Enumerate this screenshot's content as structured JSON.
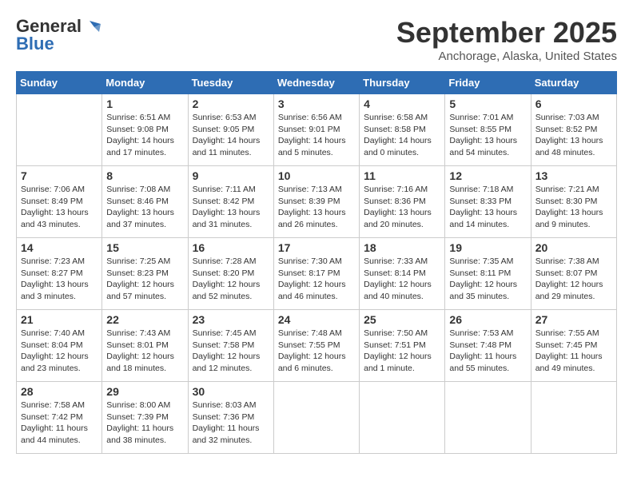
{
  "header": {
    "logo_general": "General",
    "logo_blue": "Blue",
    "month": "September 2025",
    "location": "Anchorage, Alaska, United States"
  },
  "weekdays": [
    "Sunday",
    "Monday",
    "Tuesday",
    "Wednesday",
    "Thursday",
    "Friday",
    "Saturday"
  ],
  "weeks": [
    [
      {
        "day": "",
        "info": ""
      },
      {
        "day": "1",
        "info": "Sunrise: 6:51 AM\nSunset: 9:08 PM\nDaylight: 14 hours\nand 17 minutes."
      },
      {
        "day": "2",
        "info": "Sunrise: 6:53 AM\nSunset: 9:05 PM\nDaylight: 14 hours\nand 11 minutes."
      },
      {
        "day": "3",
        "info": "Sunrise: 6:56 AM\nSunset: 9:01 PM\nDaylight: 14 hours\nand 5 minutes."
      },
      {
        "day": "4",
        "info": "Sunrise: 6:58 AM\nSunset: 8:58 PM\nDaylight: 14 hours\nand 0 minutes."
      },
      {
        "day": "5",
        "info": "Sunrise: 7:01 AM\nSunset: 8:55 PM\nDaylight: 13 hours\nand 54 minutes."
      },
      {
        "day": "6",
        "info": "Sunrise: 7:03 AM\nSunset: 8:52 PM\nDaylight: 13 hours\nand 48 minutes."
      }
    ],
    [
      {
        "day": "7",
        "info": "Sunrise: 7:06 AM\nSunset: 8:49 PM\nDaylight: 13 hours\nand 43 minutes."
      },
      {
        "day": "8",
        "info": "Sunrise: 7:08 AM\nSunset: 8:46 PM\nDaylight: 13 hours\nand 37 minutes."
      },
      {
        "day": "9",
        "info": "Sunrise: 7:11 AM\nSunset: 8:42 PM\nDaylight: 13 hours\nand 31 minutes."
      },
      {
        "day": "10",
        "info": "Sunrise: 7:13 AM\nSunset: 8:39 PM\nDaylight: 13 hours\nand 26 minutes."
      },
      {
        "day": "11",
        "info": "Sunrise: 7:16 AM\nSunset: 8:36 PM\nDaylight: 13 hours\nand 20 minutes."
      },
      {
        "day": "12",
        "info": "Sunrise: 7:18 AM\nSunset: 8:33 PM\nDaylight: 13 hours\nand 14 minutes."
      },
      {
        "day": "13",
        "info": "Sunrise: 7:21 AM\nSunset: 8:30 PM\nDaylight: 13 hours\nand 9 minutes."
      }
    ],
    [
      {
        "day": "14",
        "info": "Sunrise: 7:23 AM\nSunset: 8:27 PM\nDaylight: 13 hours\nand 3 minutes."
      },
      {
        "day": "15",
        "info": "Sunrise: 7:25 AM\nSunset: 8:23 PM\nDaylight: 12 hours\nand 57 minutes."
      },
      {
        "day": "16",
        "info": "Sunrise: 7:28 AM\nSunset: 8:20 PM\nDaylight: 12 hours\nand 52 minutes."
      },
      {
        "day": "17",
        "info": "Sunrise: 7:30 AM\nSunset: 8:17 PM\nDaylight: 12 hours\nand 46 minutes."
      },
      {
        "day": "18",
        "info": "Sunrise: 7:33 AM\nSunset: 8:14 PM\nDaylight: 12 hours\nand 40 minutes."
      },
      {
        "day": "19",
        "info": "Sunrise: 7:35 AM\nSunset: 8:11 PM\nDaylight: 12 hours\nand 35 minutes."
      },
      {
        "day": "20",
        "info": "Sunrise: 7:38 AM\nSunset: 8:07 PM\nDaylight: 12 hours\nand 29 minutes."
      }
    ],
    [
      {
        "day": "21",
        "info": "Sunrise: 7:40 AM\nSunset: 8:04 PM\nDaylight: 12 hours\nand 23 minutes."
      },
      {
        "day": "22",
        "info": "Sunrise: 7:43 AM\nSunset: 8:01 PM\nDaylight: 12 hours\nand 18 minutes."
      },
      {
        "day": "23",
        "info": "Sunrise: 7:45 AM\nSunset: 7:58 PM\nDaylight: 12 hours\nand 12 minutes."
      },
      {
        "day": "24",
        "info": "Sunrise: 7:48 AM\nSunset: 7:55 PM\nDaylight: 12 hours\nand 6 minutes."
      },
      {
        "day": "25",
        "info": "Sunrise: 7:50 AM\nSunset: 7:51 PM\nDaylight: 12 hours\nand 1 minute."
      },
      {
        "day": "26",
        "info": "Sunrise: 7:53 AM\nSunset: 7:48 PM\nDaylight: 11 hours\nand 55 minutes."
      },
      {
        "day": "27",
        "info": "Sunrise: 7:55 AM\nSunset: 7:45 PM\nDaylight: 11 hours\nand 49 minutes."
      }
    ],
    [
      {
        "day": "28",
        "info": "Sunrise: 7:58 AM\nSunset: 7:42 PM\nDaylight: 11 hours\nand 44 minutes."
      },
      {
        "day": "29",
        "info": "Sunrise: 8:00 AM\nSunset: 7:39 PM\nDaylight: 11 hours\nand 38 minutes."
      },
      {
        "day": "30",
        "info": "Sunrise: 8:03 AM\nSunset: 7:36 PM\nDaylight: 11 hours\nand 32 minutes."
      },
      {
        "day": "",
        "info": ""
      },
      {
        "day": "",
        "info": ""
      },
      {
        "day": "",
        "info": ""
      },
      {
        "day": "",
        "info": ""
      }
    ]
  ]
}
